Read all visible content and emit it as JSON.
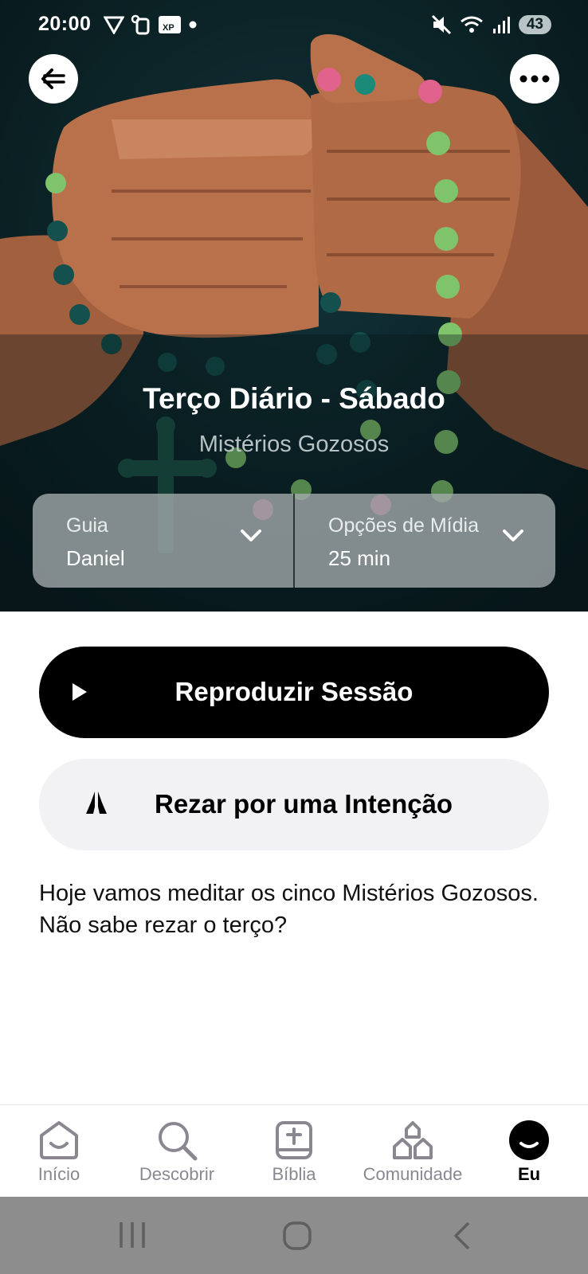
{
  "status_bar": {
    "time": "20:00",
    "battery": "43"
  },
  "session": {
    "title": "Terço Diário - Sábado",
    "subtitle": "Mistérios Gozosos"
  },
  "guide": {
    "label": "Guia",
    "value": "Daniel"
  },
  "media": {
    "label": "Opções de Mídia",
    "value": "25 min"
  },
  "actions": {
    "play_label": "Reproduzir Sessão",
    "pray_label": "Rezar por uma Intenção"
  },
  "description": "Hoje vamos meditar os cinco Mistérios Gozosos. Não sabe rezar o terço?",
  "nav": {
    "items": [
      {
        "label": "Início",
        "icon": "home-icon"
      },
      {
        "label": "Descobrir",
        "icon": "search-icon"
      },
      {
        "label": "Bíblia",
        "icon": "bible-icon"
      },
      {
        "label": "Comunidade",
        "icon": "community-icon"
      },
      {
        "label": "Eu",
        "icon": "profile-icon",
        "active": true
      }
    ]
  },
  "colors": {
    "primary": "#000000",
    "hero_bg": "#0a1f22",
    "secondary_button": "#f2f1f3",
    "nav_inactive": "#8a8790"
  }
}
